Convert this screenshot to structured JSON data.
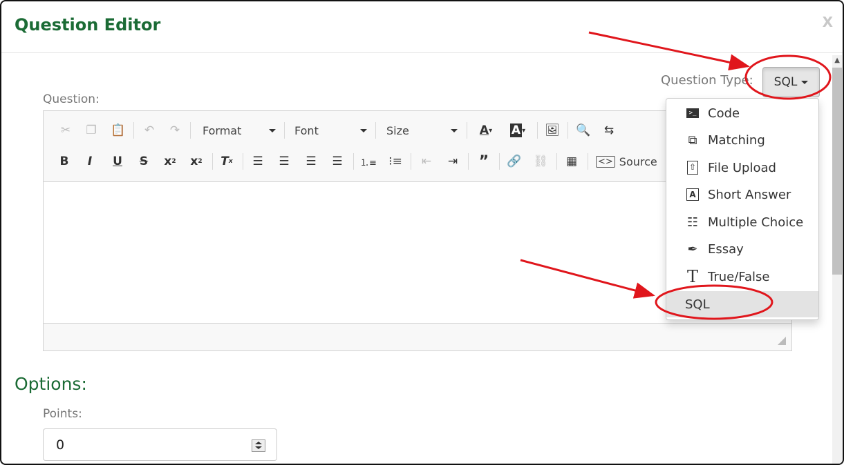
{
  "dialog": {
    "title": "Question Editor",
    "close_label": "X"
  },
  "question_type": {
    "label": "Question Type:",
    "selected": "SQL"
  },
  "question": {
    "label": "Question:",
    "toolbar": {
      "format_label": "Format",
      "font_label": "Font",
      "size_label": "Size",
      "source_label": "Source"
    }
  },
  "menu": {
    "items": [
      {
        "label": "Code",
        "icon": "terminal-icon"
      },
      {
        "label": "Matching",
        "icon": "matching-icon"
      },
      {
        "label": "File Upload",
        "icon": "file-upload-icon"
      },
      {
        "label": "Short Answer",
        "icon": "short-answer-icon"
      },
      {
        "label": "Multiple Choice",
        "icon": "list-icon"
      },
      {
        "label": "Essay",
        "icon": "pen-nib-icon"
      },
      {
        "label": "True/False",
        "icon": "text-icon"
      },
      {
        "label": "SQL",
        "icon": ""
      }
    ]
  },
  "options": {
    "heading": "Options:",
    "points_label": "Points:",
    "points_value": "0"
  },
  "colors": {
    "accent": "#1b6b35",
    "annotation": "#e0161c"
  }
}
